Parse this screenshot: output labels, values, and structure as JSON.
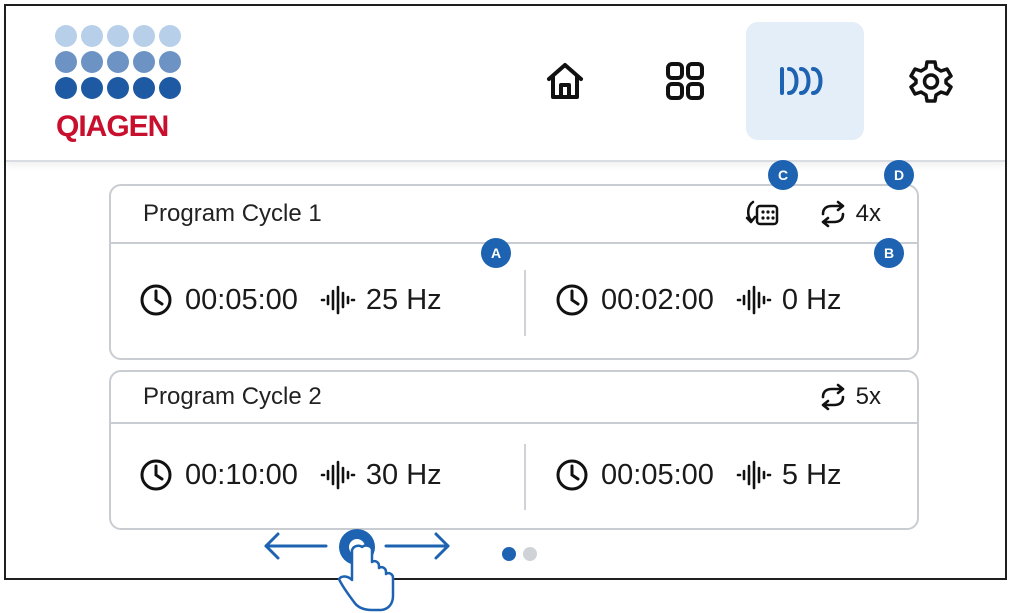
{
  "brand": {
    "name": "QIAGEN",
    "color": "#c8102e",
    "dot_colors": [
      "#b7cfe9",
      "#6c93c4",
      "#1d5aa3"
    ]
  },
  "nav": {
    "items": [
      {
        "name": "home",
        "icon": "home-icon",
        "active": false
      },
      {
        "name": "grid",
        "icon": "grid-icon",
        "active": false
      },
      {
        "name": "cycles",
        "icon": "cycles-icon",
        "active": true
      },
      {
        "name": "settings",
        "icon": "gear-icon",
        "active": false
      }
    ],
    "active_bg": "#e4eef8"
  },
  "cycles": [
    {
      "title": "Program Cycle 1",
      "repeat": "4x",
      "steps": [
        {
          "time": "00:05:00",
          "freq": "25 Hz"
        },
        {
          "time": "00:02:00",
          "freq": "0 Hz"
        }
      ]
    },
    {
      "title": "Program Cycle 2",
      "repeat": "5x",
      "steps": [
        {
          "time": "00:10:00",
          "freq": "30 Hz"
        },
        {
          "time": "00:05:00",
          "freq": "5 Hz"
        }
      ]
    }
  ],
  "callouts": {
    "a": "A",
    "b": "B",
    "c": "C",
    "d": "D",
    "color": "#1d63b1"
  },
  "pager": {
    "pages": 2,
    "current": 1,
    "active_color": "#1d63b1",
    "inactive_color": "#cfd3d7"
  }
}
